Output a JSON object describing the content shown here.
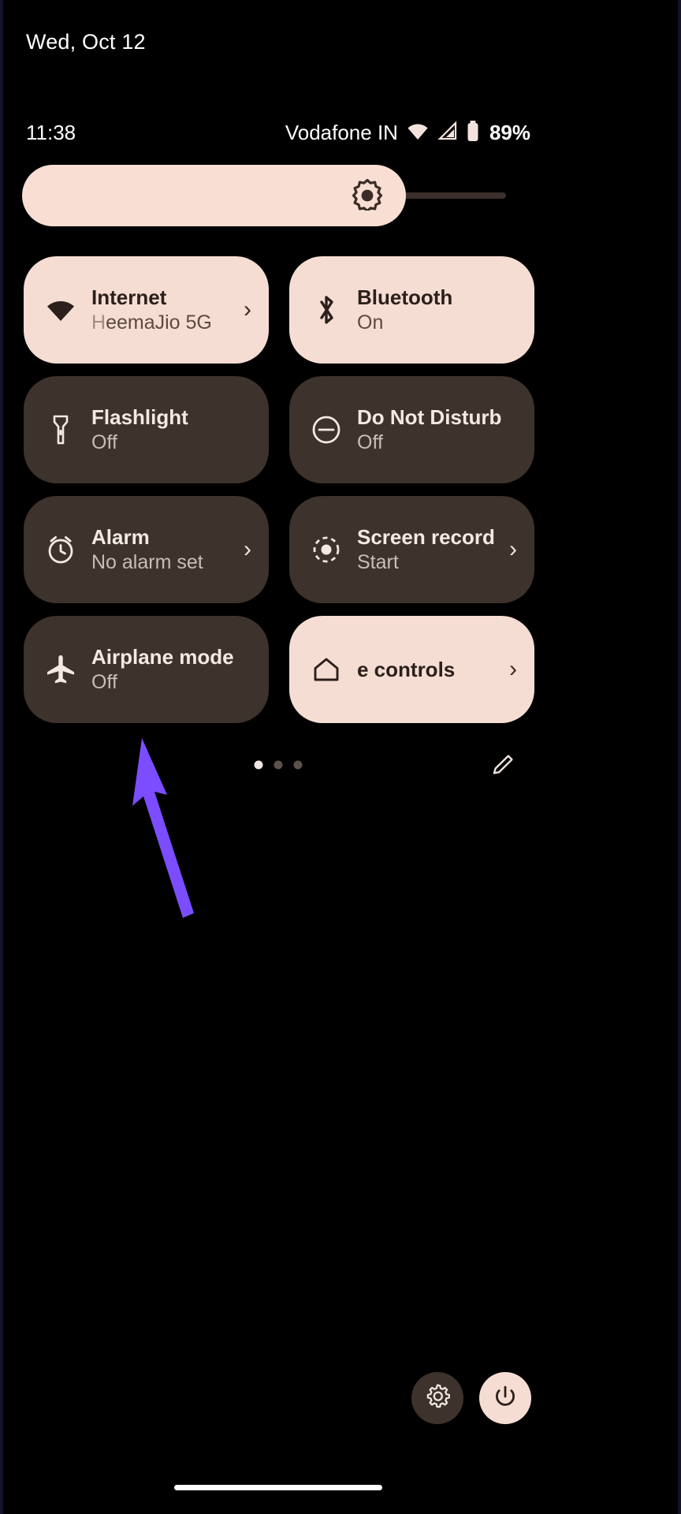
{
  "screen": {
    "name": "Android Quick Settings panel",
    "background_color": "#000000",
    "accent_active": "#F6DDD3",
    "accent_inactive": "#3D322C"
  },
  "date_header": {
    "text": "Wed, Oct 12"
  },
  "status_bar": {
    "time": "11:38",
    "carrier": "Vodafone IN",
    "battery_percent": "89%",
    "icons": [
      "wifi-icon",
      "cellular-signal-icon",
      "battery-icon"
    ]
  },
  "brightness": {
    "label": "Brightness",
    "icon": "brightness-sun-icon",
    "value_percent": 79
  },
  "tiles": [
    {
      "title": "Internet",
      "subtitle": "HeemaJio 5G",
      "state": "active",
      "icon": "wifi-icon",
      "has_chevron": true
    },
    {
      "title": "Bluetooth",
      "subtitle": "On",
      "state": "active",
      "icon": "bluetooth-icon",
      "has_chevron": false
    },
    {
      "title": "Flashlight",
      "subtitle": "Off",
      "state": "inactive",
      "icon": "flashlight-icon",
      "has_chevron": false
    },
    {
      "title": "Do Not Disturb",
      "subtitle": "Off",
      "state": "inactive",
      "icon": "do-not-disturb-icon",
      "has_chevron": false
    },
    {
      "title": "Alarm",
      "subtitle": "No alarm set",
      "state": "inactive",
      "icon": "alarm-clock-icon",
      "has_chevron": true
    },
    {
      "title": "Screen record",
      "subtitle": "Start",
      "state": "inactive",
      "icon": "screen-record-icon",
      "has_chevron": true
    },
    {
      "title": "Airplane mode",
      "subtitle": "Off",
      "state": "inactive",
      "icon": "airplane-icon",
      "has_chevron": false
    },
    {
      "title": "e controls",
      "subtitle": "",
      "state": "active",
      "icon": "home-icon",
      "has_chevron": true
    }
  ],
  "footer": {
    "page_dots": {
      "total": 3,
      "active_index": 0
    },
    "edit_icon": "pencil-edit-icon"
  },
  "bottom_buttons": [
    {
      "name": "settings-button",
      "icon": "gear-icon"
    },
    {
      "name": "power-button",
      "icon": "power-icon"
    }
  ],
  "annotation": {
    "type": "arrow",
    "color": "#7C4DFF",
    "points_to": "Airplane mode"
  },
  "nav_bar": {
    "handle": "gesture-nav-handle"
  }
}
